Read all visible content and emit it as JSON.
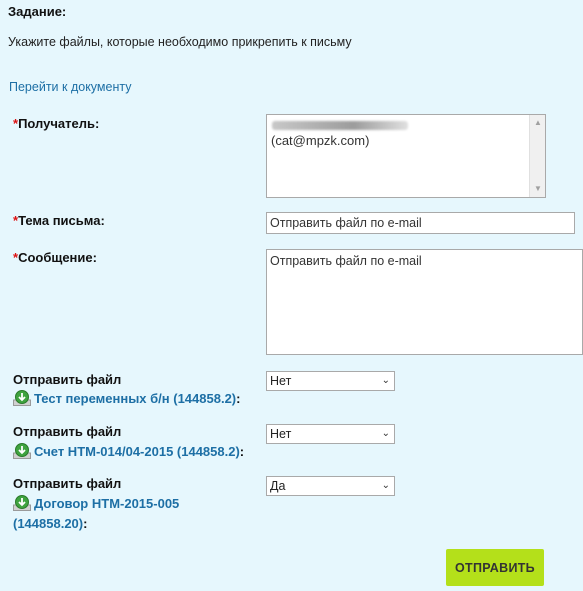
{
  "task": {
    "title": "Задание:",
    "description": "Укажите файлы, которые необходимо прикрепить к письму",
    "doc_link": "Перейти к документу"
  },
  "form": {
    "required_mark": "*",
    "recipient_label": "Получатель:",
    "recipient_value": "(cat@mpzk.com)",
    "subject_label": "Тема письма:",
    "subject_value": "Отправить файл по e-mail",
    "message_label": "Сообщение:",
    "message_value": "Отправить файл по e-mail"
  },
  "files": [
    {
      "label": "Отправить файл",
      "name": "Тест переменных б/н (144858.2)",
      "suffix": ":",
      "selected": "Нет"
    },
    {
      "label": "Отправить файл",
      "name": "Счет НТМ-014/04-2015 (144858.2)",
      "suffix": ":",
      "selected": "Нет"
    },
    {
      "label": "Отправить файл",
      "name": "Договор НТМ-2015-005 (144858.20)",
      "suffix": ":",
      "selected": "Да"
    }
  ],
  "send_button": "ОТПРАВИТЬ",
  "colors": {
    "background": "#e6f7fd",
    "link": "#1d6fa5",
    "required": "#dd1111",
    "button": "#b4e01a"
  }
}
